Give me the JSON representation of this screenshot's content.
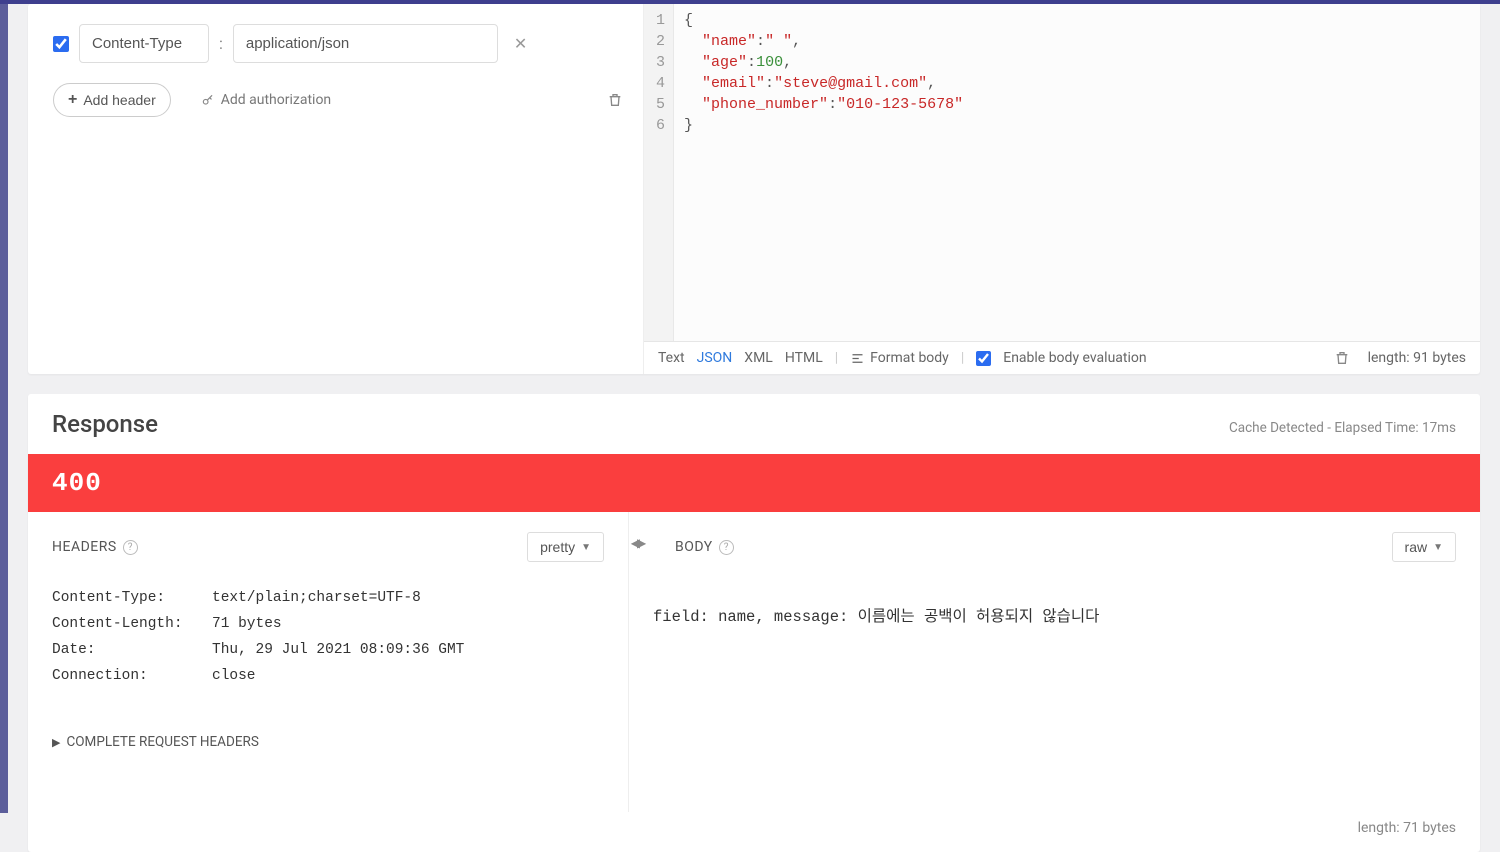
{
  "request": {
    "header_key": "Content-Type",
    "header_value": "application/json",
    "add_header_label": "Add header",
    "add_auth_label": "Add authorization",
    "body_lines": {
      "l1": "{",
      "l6": "}"
    },
    "json_body": {
      "name_key": "\"name\"",
      "name_val": "\" \"",
      "age_key": "\"age\"",
      "age_val": "100",
      "email_key": "\"email\"",
      "email_val": "\"steve@gmail.com\"",
      "phone_key": "\"phone_number\"",
      "phone_val": "\"010-123-5678\""
    },
    "toolbar": {
      "text": "Text",
      "json": "JSON",
      "xml": "XML",
      "html": "HTML",
      "format_body": "Format body",
      "enable_eval": "Enable body evaluation",
      "length": "length: 91 bytes"
    }
  },
  "response": {
    "title": "Response",
    "meta": "Cache Detected - Elapsed Time: 17ms",
    "status_code": "400",
    "headers_label": "HEADERS",
    "body_label": "BODY",
    "pretty_label": "pretty",
    "raw_label": "raw",
    "headers": {
      "content_type_k": "Content-Type:",
      "content_type_v": "text/plain;charset=UTF-8",
      "content_length_k": "Content-Length:",
      "content_length_v": "71 bytes",
      "date_k": "Date:",
      "date_v": "Thu, 29 Jul 2021 08:09:36 GMT",
      "connection_k": "Connection:",
      "connection_v": "close"
    },
    "complete_headers_label": "COMPLETE REQUEST HEADERS",
    "body_text": "field: name,    message: 이름에는 공백이 허용되지 않습니다",
    "body_length": "length: 71 bytes"
  }
}
